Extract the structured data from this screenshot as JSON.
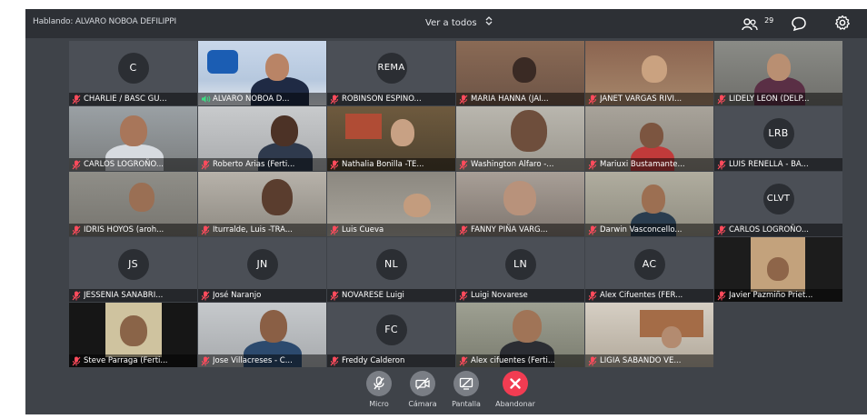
{
  "header": {
    "speaking": "Hablando: ALVARO NOBOA DEFILIPPI",
    "view_label": "Ver a todos",
    "participant_count": "29"
  },
  "tiles": [
    {
      "name": "CHARLIE / BASC GU...",
      "initials": "C",
      "muted": true
    },
    {
      "name": "ALVARO NOBOA D...",
      "muted": false,
      "speaking": true
    },
    {
      "name": "ROBINSON ESPINO...",
      "initials": "REMA",
      "muted": true
    },
    {
      "name": "MARIA HANNA (JAI...",
      "muted": true
    },
    {
      "name": "JANET VARGAS RIVI...",
      "muted": true
    },
    {
      "name": "LIDELY LEON (DELP...",
      "muted": true
    },
    {
      "name": "CARLOS LOGROÑO...",
      "muted": true
    },
    {
      "name": "Roberto Arias (Ferti...",
      "muted": true
    },
    {
      "name": "Nathalia Bonilla -TE...",
      "muted": true
    },
    {
      "name": "Washington Alfaro -...",
      "muted": true
    },
    {
      "name": "Mariuxi Bustamante...",
      "muted": true
    },
    {
      "name": "LUIS RENELLA - BA...",
      "initials": "LRB",
      "muted": true
    },
    {
      "name": "IDRIS HOYOS (aroh...",
      "muted": true
    },
    {
      "name": "Iturralde, Luis -TRA...",
      "muted": true
    },
    {
      "name": "Luis Cueva",
      "muted": true
    },
    {
      "name": "FANNY PIÑA VARG...",
      "muted": true
    },
    {
      "name": "Darwin Vasconcello...",
      "muted": true
    },
    {
      "name": "CARLOS LOGROÑO...",
      "initials": "CLVT",
      "muted": true
    },
    {
      "name": "JESSENIA SANABRI...",
      "initials": "JS",
      "muted": true
    },
    {
      "name": "José Naranjo",
      "initials": "JN",
      "muted": true
    },
    {
      "name": "NOVARESE Luigi",
      "initials": "NL",
      "muted": true
    },
    {
      "name": "Luigi Novarese",
      "initials": "LN",
      "muted": true
    },
    {
      "name": "Alex Cifuentes (FER...",
      "initials": "AC",
      "muted": true
    },
    {
      "name": "Javier Pazmiño Priet...",
      "muted": true
    },
    {
      "name": "Steve Parraga (Ferti...",
      "muted": true
    },
    {
      "name": "Jose Villacreses - C...",
      "muted": true
    },
    {
      "name": "Freddy Calderon",
      "initials": "FC",
      "muted": true
    },
    {
      "name": "Alex cifuentes (Ferti...",
      "muted": true
    },
    {
      "name": "LIGIA SABANDO VE...",
      "muted": true
    }
  ],
  "controls": {
    "micro": "Micro",
    "camera": "Cámara",
    "screen": "Pantalla",
    "leave": "Abandonar"
  },
  "icons": {
    "muted": "mic-off-icon",
    "speaking": "speaker-icon",
    "participants": "people-icon",
    "chat": "chat-icon",
    "settings": "gear-icon"
  },
  "colors": {
    "muted_red": "#ff4b5c",
    "speaking_green": "#3ddc84",
    "leave_red": "#f23c52",
    "control_grey": "#7a7e85"
  }
}
